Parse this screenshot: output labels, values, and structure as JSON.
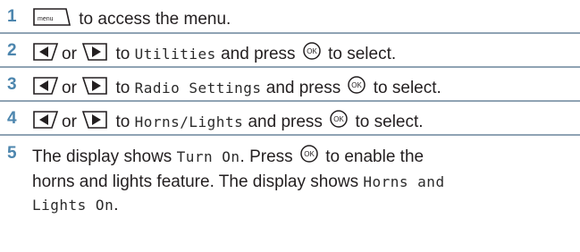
{
  "steps": [
    {
      "number": "1",
      "icon": "menu-key-icon",
      "menu_key_label": "menu",
      "text": "to access the menu."
    },
    {
      "number": "2",
      "left_icon": "left-arrow-key-icon",
      "or": "or",
      "right_icon": "right-arrow-key-icon",
      "to": "to",
      "target": "Utilities",
      "and_press": "and press",
      "ok_icon": "ok-key-icon",
      "ok_label": "OK",
      "end": "to select."
    },
    {
      "number": "3",
      "left_icon": "left-arrow-key-icon",
      "or": "or",
      "right_icon": "right-arrow-key-icon",
      "to": "to",
      "target": "Radio Settings",
      "and_press": "and press",
      "ok_icon": "ok-key-icon",
      "ok_label": "OK",
      "end": "to select."
    },
    {
      "number": "4",
      "left_icon": "left-arrow-key-icon",
      "or": "or",
      "right_icon": "right-arrow-key-icon",
      "to": "to",
      "target": "Horns/Lights",
      "and_press": "and press",
      "ok_icon": "ok-key-icon",
      "ok_label": "OK",
      "end": "to select."
    },
    {
      "number": "5",
      "line1_a": "The display shows",
      "display1": "Turn On",
      "line1_b": ". Press",
      "ok_icon": "ok-key-icon",
      "ok_label": "OK",
      "line1_c": "to enable the",
      "line2_a": "horns and lights feature. The display shows",
      "display2a": "Horns and",
      "display2b": "Lights On",
      "period": "."
    }
  ],
  "colors": {
    "step_number": "#4d86ae",
    "divider": "#8fa3b4",
    "text": "#231f20"
  }
}
